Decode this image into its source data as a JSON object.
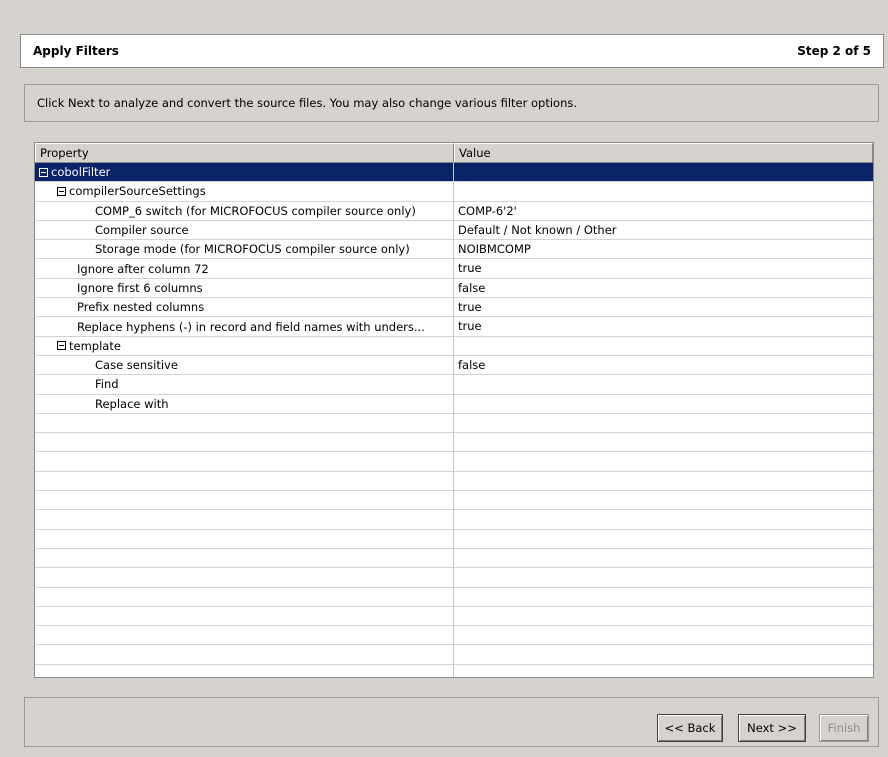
{
  "header": {
    "title": "Apply Filters",
    "step": "Step 2 of 5"
  },
  "instructions": "Click Next to analyze and convert the source files. You may also change various filter options.",
  "table": {
    "columns": [
      "Property",
      "Value"
    ],
    "rows": [
      {
        "property": "cobolFilter",
        "value": "",
        "level": 0,
        "expander": true,
        "selected": true
      },
      {
        "property": "compilerSourceSettings",
        "value": "",
        "level": 1,
        "expander": true,
        "selected": false
      },
      {
        "property": "COMP_6 switch (for MICROFOCUS compiler source only)",
        "value": "COMP-6'2'",
        "level": 2,
        "expander": false,
        "selected": false
      },
      {
        "property": "Compiler source",
        "value": "Default / Not known / Other",
        "level": 2,
        "expander": false,
        "selected": false
      },
      {
        "property": "Storage mode (for MICROFOCUS compiler source only)",
        "value": "NOIBMCOMP",
        "level": 2,
        "expander": false,
        "selected": false
      },
      {
        "property": "Ignore after column 72",
        "value": "true",
        "level": 1,
        "expander": false,
        "selected": false
      },
      {
        "property": "Ignore first 6 columns",
        "value": "false",
        "level": 1,
        "expander": false,
        "selected": false
      },
      {
        "property": "Prefix nested columns",
        "value": "true",
        "level": 1,
        "expander": false,
        "selected": false
      },
      {
        "property": "Replace hyphens (-) in record and field names with unders...",
        "value": "true",
        "level": 1,
        "expander": false,
        "selected": false
      },
      {
        "property": "template",
        "value": "",
        "level": 1,
        "expander": true,
        "selected": false
      },
      {
        "property": "Case sensitive",
        "value": "false",
        "level": 2,
        "expander": false,
        "selected": false
      },
      {
        "property": "Find",
        "value": "",
        "level": 2,
        "expander": false,
        "selected": false
      },
      {
        "property": "Replace with",
        "value": "",
        "level": 2,
        "expander": false,
        "selected": false
      }
    ],
    "empty_rows": 14
  },
  "buttons": {
    "back": "<< Back",
    "next": "Next >>",
    "finish": "Finish"
  },
  "colors": {
    "selection": "#0a246a",
    "background": "#d6d3ce"
  }
}
